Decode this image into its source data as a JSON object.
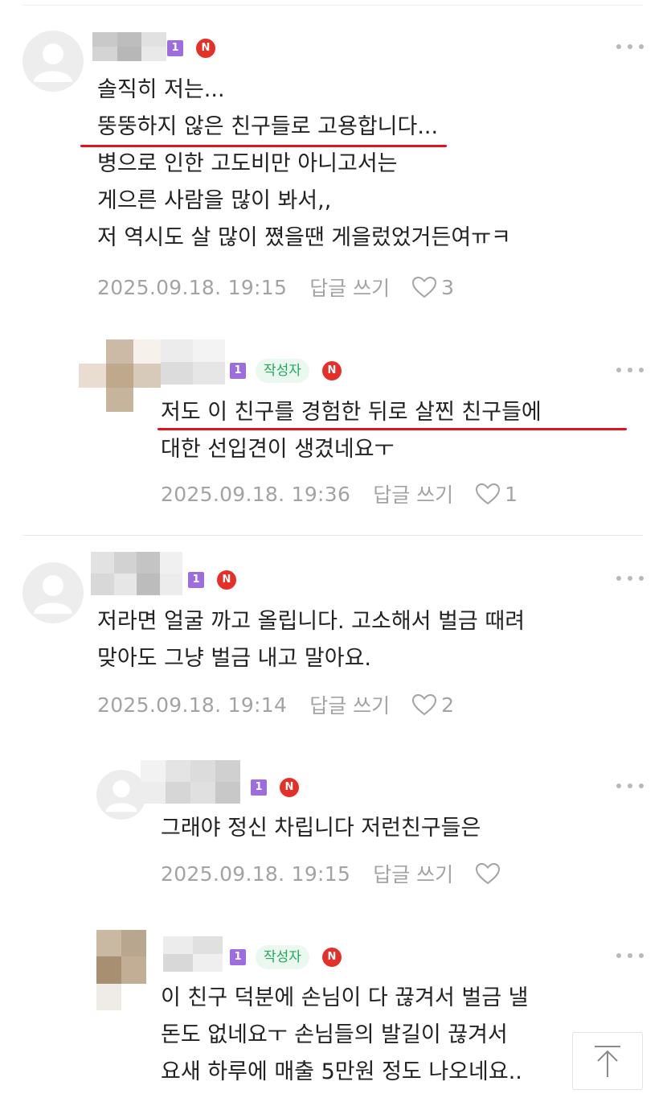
{
  "comments": [
    {
      "lines": [
        "솔직히 저는...",
        "뚱뚱하지 않은 친구들로 고용합니다...",
        "병으로 인한 고도비만 아니고서는",
        "게으른 사람을 많이 봐서,,",
        "저 역시도 살 많이 쪘을땐 게을렀었거든여ㅠㅋ"
      ],
      "level": "1",
      "badge": "N",
      "date": "2025.09.18. 19:15",
      "reply_label": "답글 쓰기",
      "likes": "3"
    },
    {
      "lines": [
        "저도 이 친구를 경험한 뒤로 살찐 친구들에",
        "대한 선입견이 생겼네요ㅜ"
      ],
      "level": "1",
      "author_badge": "작성자",
      "badge": "N",
      "date": "2025.09.18. 19:36",
      "reply_label": "답글 쓰기",
      "likes": "1"
    },
    {
      "lines": [
        "저라면 얼굴 까고 올립니다. 고소해서 벌금 때려",
        "맞아도 그냥 벌금 내고 말아요."
      ],
      "level": "1",
      "badge": "N",
      "date": "2025.09.18. 19:14",
      "reply_label": "답글 쓰기",
      "likes": "2"
    },
    {
      "lines": [
        "그래야 정신 차립니다 저런친구들은"
      ],
      "level": "1",
      "badge": "N",
      "date": "2025.09.18. 19:15",
      "reply_label": "답글 쓰기",
      "likes": ""
    },
    {
      "lines": [
        "이 친구 덕분에 손님이 다 끊겨서 벌금 낼",
        "돈도 없네요ㅜ 손님들의 발길이 끊겨서",
        "요새 하루에 매출 5만원 정도 나오네요.."
      ],
      "level": "1",
      "author_badge": "작성자",
      "badge": "N"
    }
  ],
  "icons": {
    "avatar": "default-person-avatar-icon",
    "more": "more-dots-icon",
    "like": "heart-outline-icon",
    "scroll_top": "arrow-up-icon"
  },
  "colors": {
    "level_badge": "#9d6cde",
    "new_badge": "#e5302a",
    "author_badge_bg": "#eaf8ef",
    "author_badge_text": "#22a85a",
    "highlight_underline": "#e0121b",
    "meta_text": "#a3a3a3"
  }
}
